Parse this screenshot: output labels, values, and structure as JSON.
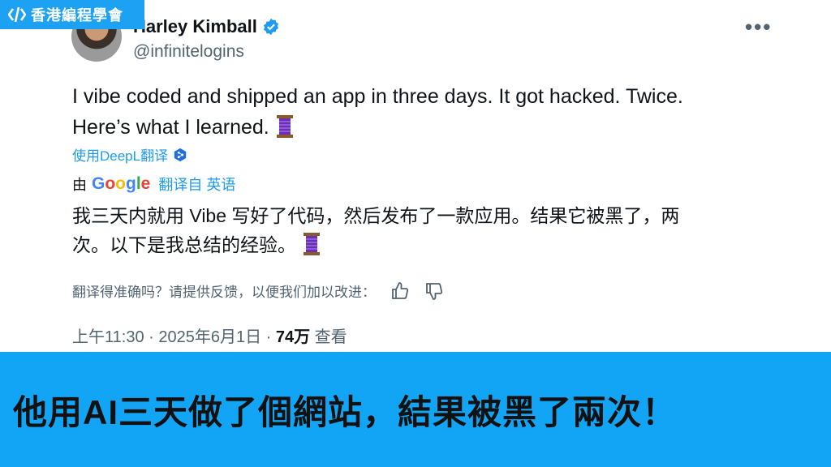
{
  "watermark": {
    "logo_text": "香港編程學會",
    "mark": "</>"
  },
  "tweet": {
    "author_name": "Harley Kimball",
    "handle": "@infinitelogins",
    "text_line1": "I vibe coded and shipped an app in three days. It got hacked. Twice.",
    "text_line2": "Here’s what I learned.",
    "deepl_label": "使用DeepL翻译",
    "by_label": "由",
    "google_letters": [
      "G",
      "o",
      "o",
      "g",
      "l",
      "e"
    ],
    "translated_from_label": "翻译自 英语",
    "translation_line1": "我三天内就用 Vibe 写好了代码，然后发布了一款应用。结果它被黑了，两",
    "translation_line2": "次。以下是我总结的经验。",
    "feedback_prompt": "翻译得准确吗？请提供反馈，以便我们加以改进：",
    "time": "上午11:30 · 2025年6月1日 · ",
    "views": "74万",
    "views_label": " 查看",
    "more_label": "•••"
  },
  "banner": {
    "headline": "他用AI三天做了個網站，結果被黑了兩次！"
  },
  "colors": {
    "accent": "#1d9bf0",
    "banner_bg": "#12a5f5",
    "verified": "#1d9bf0"
  },
  "icons": [
    "code-logo-icon",
    "verified-badge-icon",
    "more-icon",
    "spool-emoji-icon",
    "deepl-icon",
    "thumbs-up-icon",
    "thumbs-down-icon"
  ]
}
